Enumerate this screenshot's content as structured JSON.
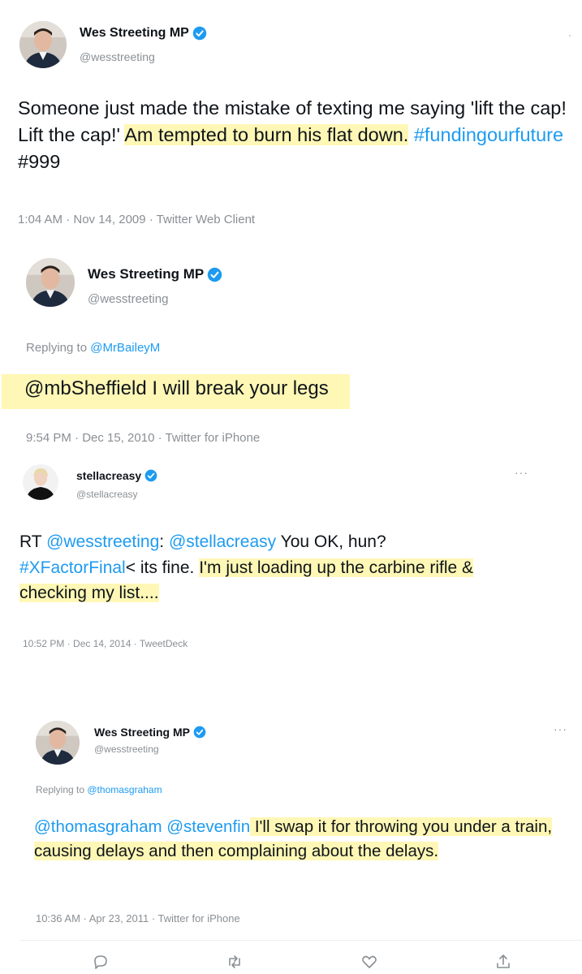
{
  "colors": {
    "link": "#1d9bf0",
    "verified": "#1d9bf0",
    "highlight": "#fff078",
    "muted": "#8a8f94"
  },
  "tweets": [
    {
      "name": "Wes Streeting MP",
      "handle": "@wesstreeting",
      "avatar": "wes-streeting-photo",
      "verified": true,
      "segments": {
        "s1": "Someone just made the mistake of texting me saying 'lift the cap! Lift the cap!' ",
        "s2": "Am tempted to burn his flat down.",
        "s3": " ",
        "s4": "#fundingourfuture",
        "s5": " #999"
      },
      "meta": "1:04 AM · Nov 14, 2009 · Twitter Web Client"
    },
    {
      "name": "Wes Streeting MP",
      "handle": "@wesstreeting",
      "avatar": "wes-streeting-photo",
      "verified": true,
      "replying_prefix": "Replying to ",
      "replying_to": "@MrBaileyM",
      "segments": {
        "s1": "@mbSheffield I will break your legs"
      },
      "meta": "9:54 PM · Dec 15, 2010 · Twitter for iPhone"
    },
    {
      "name": "stellacreasy",
      "handle": "@stellacreasy",
      "avatar": "stella-creasy-photo",
      "verified": true,
      "more": "···",
      "segments": {
        "s1": "RT ",
        "s2": "@wesstreeting",
        "s3": ": ",
        "s4": "@stellacreasy",
        "s5": " You OK, hun?",
        "s6": "#XFactorFinal",
        "s7": "< its fine. ",
        "s8": "I'm just loading up the carbine rifle & checking my list....",
        "s9": ""
      },
      "meta": "10:52 PM · Dec 14, 2014 · TweetDeck"
    },
    {
      "name": "Wes Streeting MP",
      "handle": "@wesstreeting",
      "avatar": "wes-streeting-photo",
      "verified": true,
      "more": "···",
      "replying_prefix": "Replying to ",
      "replying_to": "@thomasgraham",
      "segments": {
        "s1": "@thomasgraham",
        "s2": " ",
        "s3": "@stevenfin",
        "s4": " I'll swap it for throwing you under a train, causing delays and then complaining about the delays."
      },
      "meta": "10:36 AM · Apr 23, 2011 · Twitter for iPhone",
      "actions": [
        "reply-icon",
        "retweet-icon",
        "like-icon",
        "share-icon"
      ]
    }
  ]
}
